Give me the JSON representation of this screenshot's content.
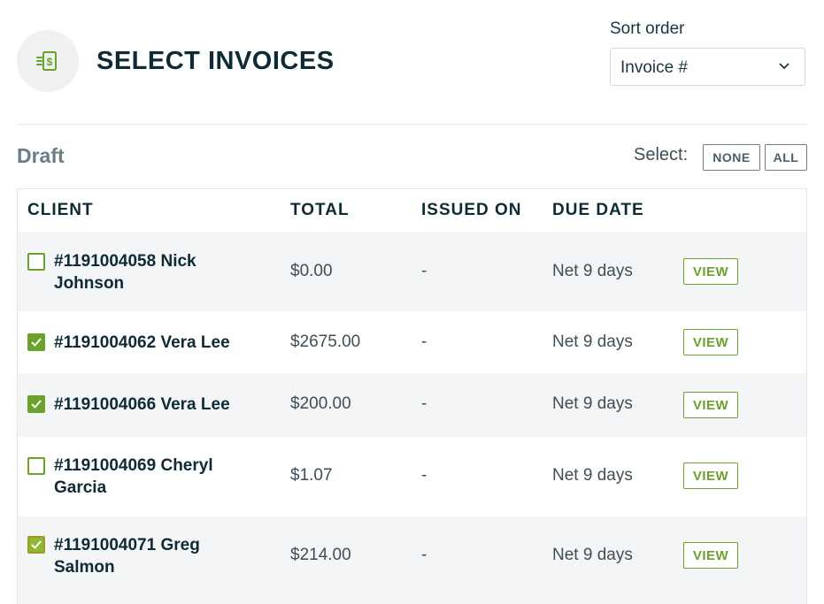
{
  "header": {
    "title": "SELECT INVOICES",
    "icon": "invoice-dollar-icon",
    "sort": {
      "label": "Sort order",
      "value": "Invoice #"
    }
  },
  "section": {
    "title": "Draft",
    "select_label": "Select:",
    "none_label": "NONE",
    "all_label": "ALL"
  },
  "table": {
    "columns": [
      "CLIENT",
      "TOTAL",
      "ISSUED ON",
      "DUE DATE"
    ],
    "view_label": "VIEW",
    "rows": [
      {
        "client_line1": "#1191004058 Nick",
        "client_line2": "Johnson",
        "total": "$0.00",
        "issued": "-",
        "due": "Net 9 days",
        "checked": false
      },
      {
        "client_line1": "#1191004062 Vera Lee",
        "client_line2": "",
        "total": "$2675.00",
        "issued": "-",
        "due": "Net 9 days",
        "checked": true
      },
      {
        "client_line1": "#1191004066 Vera Lee",
        "client_line2": "",
        "total": "$200.00",
        "issued": "-",
        "due": "Net 9 days",
        "checked": true
      },
      {
        "client_line1": "#1191004069 Cheryl",
        "client_line2": "Garcia",
        "total": "$1.07",
        "issued": "-",
        "due": "Net 9 days",
        "checked": false
      },
      {
        "client_line1": "#1191004071 Greg",
        "client_line2": "Salmon",
        "total": "$214.00",
        "issued": "-",
        "due": "Net 9 days",
        "checked": true
      }
    ]
  },
  "colors": {
    "accent": "#6aa22b",
    "text": "#0e2a35",
    "muted": "#6b7d86",
    "row_alt": "#f4f5f6"
  }
}
